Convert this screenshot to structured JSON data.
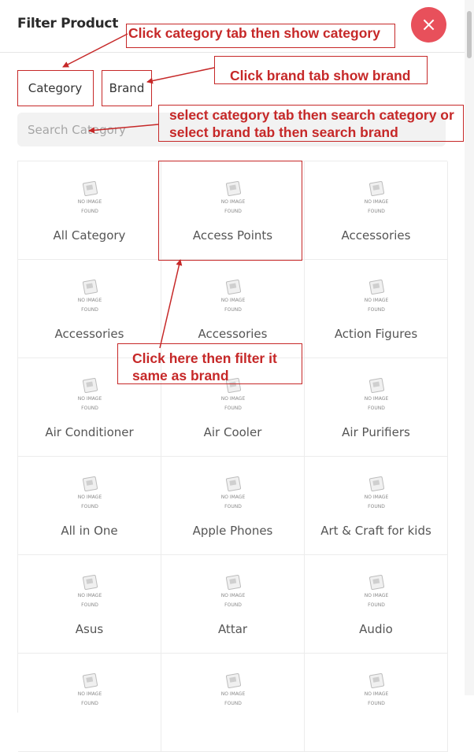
{
  "header": {
    "title": "Filter Product",
    "close_label": "×"
  },
  "tabs": [
    {
      "label": "Category"
    },
    {
      "label": "Brand"
    }
  ],
  "search": {
    "placeholder": "Search Category",
    "value": ""
  },
  "no_image_text": {
    "line1": "NO IMAGE",
    "line2": "FOUND"
  },
  "categories": [
    "All Category",
    "Access Points",
    "Accessories",
    "Accessories",
    "Accessories",
    "Action Figures",
    "Air Conditioner",
    "Air Cooler",
    "Air Purifiers",
    "All in One",
    "Apple Phones",
    "Art & Craft for kids",
    "Asus",
    "Attar",
    "Audio",
    "",
    "",
    ""
  ],
  "annotations": {
    "category_tab": "Click category tab then show category",
    "brand_tab": "Click brand tab show brand",
    "search_line1": "select category tab then search category or",
    "search_line2": "select brand tab then search brand",
    "filter_line1": "Click here then filter it",
    "filter_line2": "same as brand"
  },
  "colors": {
    "annotation": "#c62828",
    "close_button": "#e8505b"
  }
}
